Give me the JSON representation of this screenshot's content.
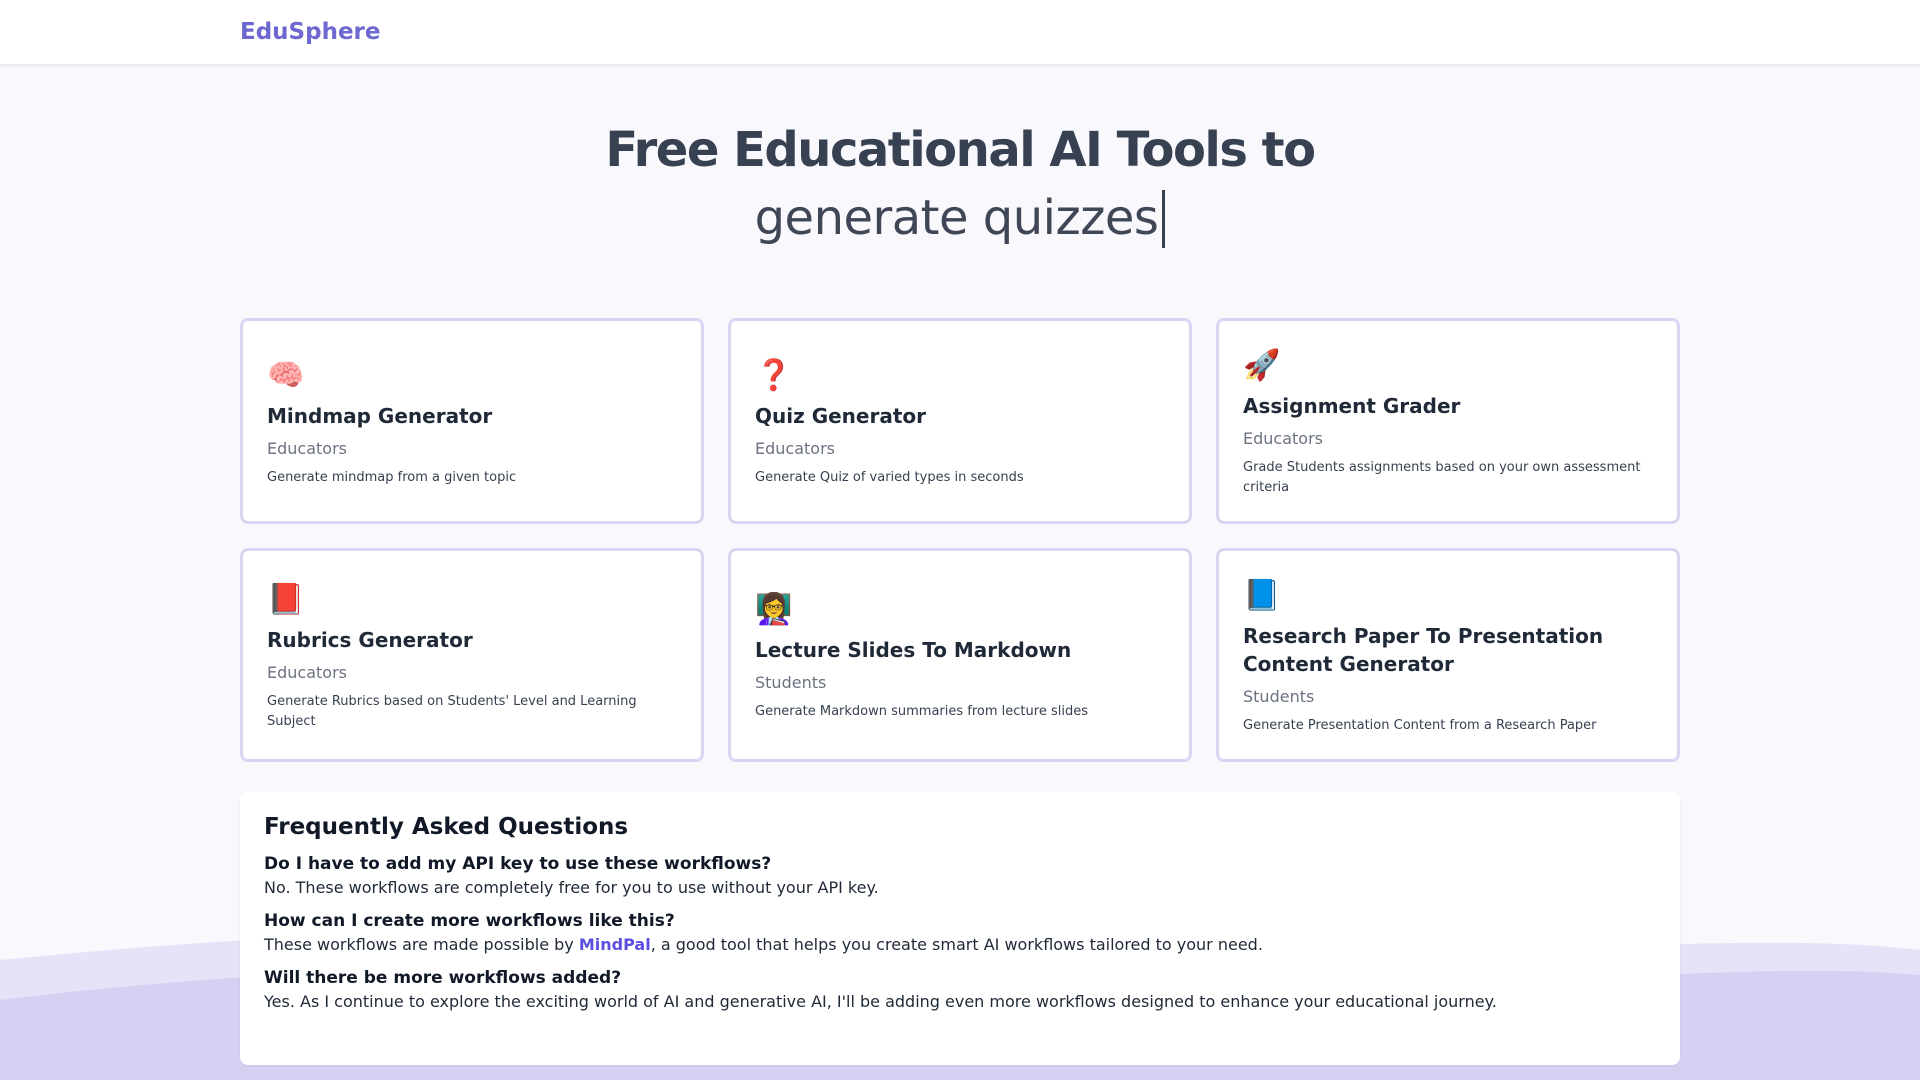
{
  "brand": "EduSphere",
  "hero": {
    "title": "Free Educational AI Tools to",
    "typed": "generate quizzes"
  },
  "cards": [
    {
      "icon": "🧠",
      "icon_name": "brain-icon",
      "title": "Mindmap Generator",
      "audience": "Educators",
      "description": "Generate mindmap from a given topic"
    },
    {
      "icon": "❓",
      "icon_name": "question-mark-icon",
      "title": "Quiz Generator",
      "audience": "Educators",
      "description": "Generate Quiz of varied types in seconds"
    },
    {
      "icon": "🚀",
      "icon_name": "rocket-icon",
      "title": "Assignment Grader",
      "audience": "Educators",
      "description": "Grade Students assignments based on your own assessment criteria"
    },
    {
      "icon": "📕",
      "icon_name": "book-icon",
      "title": "Rubrics Generator",
      "audience": "Educators",
      "description": "Generate Rubrics based on Students' Level and Learning Subject"
    },
    {
      "icon": "👩‍🏫",
      "icon_name": "teacher-icon",
      "title": "Lecture Slides To Markdown",
      "audience": "Students",
      "description": "Generate Markdown summaries from lecture slides"
    },
    {
      "icon": "📘",
      "icon_name": "blue-book-icon",
      "title": "Research Paper To Presentation Content Generator",
      "audience": "Students",
      "description": "Generate Presentation Content from a Research Paper"
    }
  ],
  "faq": {
    "heading": "Frequently Asked Questions",
    "items": [
      {
        "question": "Do I have to add my API key to use these workflows?",
        "answer": "No. These workflows are completely free for you to use without your API key."
      },
      {
        "question": "How can I create more workflows like this?",
        "answer_before": "These workflows are made possible by ",
        "link": "MindPal",
        "answer_after": ", a good tool that helps you create smart AI workflows tailored to your need."
      },
      {
        "question": "Will there be more workflows added?",
        "answer": "Yes. As I continue to explore the exciting world of AI and generative AI, I'll be adding even more workflows designed to enhance your educational journey."
      }
    ]
  },
  "colors": {
    "brand": "#6d67d0",
    "card_border": "#d9d6f3",
    "link": "#5b4ee0",
    "wave": "#d6d1f3"
  }
}
